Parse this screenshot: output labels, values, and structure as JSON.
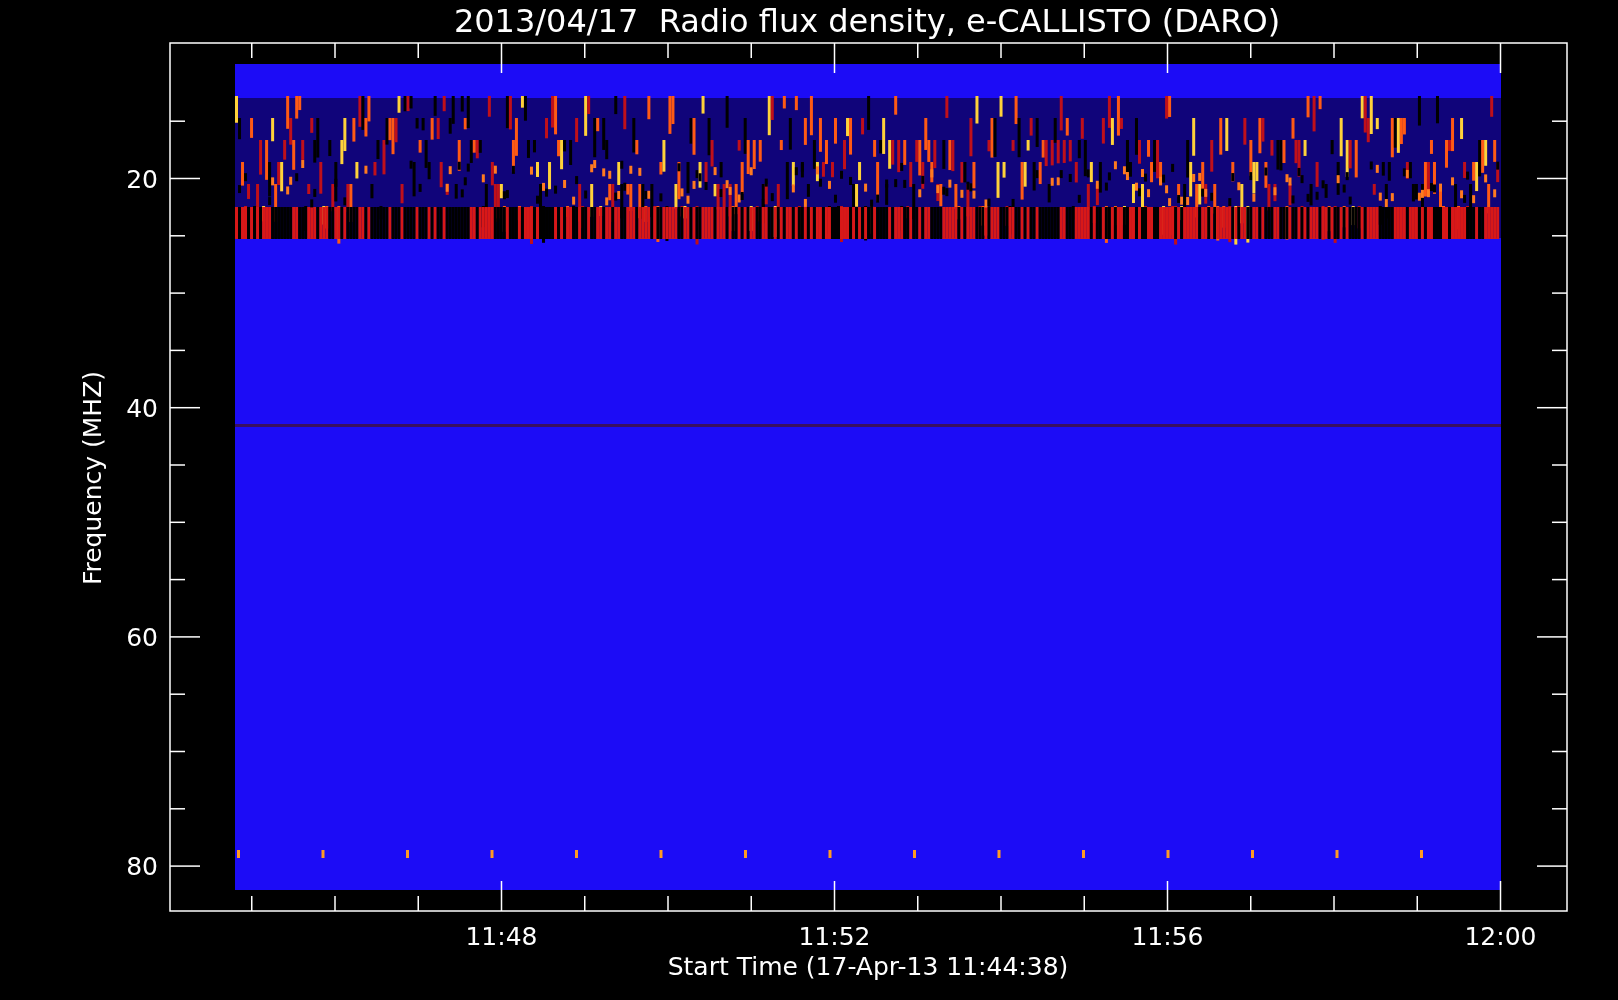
{
  "title": "2013/04/17  Radio flux density, e-CALLISTO (DARO)",
  "y_axis": {
    "label": "Frequency (MHZ)",
    "tick_labels": [
      "20",
      "40",
      "60",
      "80"
    ]
  },
  "x_axis": {
    "label": "Start Time (17-Apr-13 11:44:38)",
    "tick_labels": [
      "11:48",
      "11:52",
      "11:56",
      "12:00"
    ]
  }
}
